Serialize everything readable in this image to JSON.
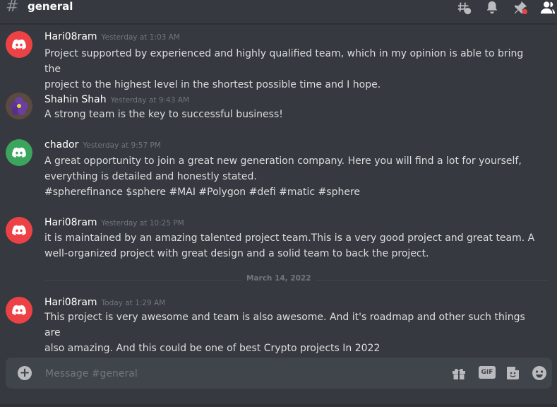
{
  "channel": {
    "hash_symbol": "#",
    "name": "general"
  },
  "header_icons": [
    "threads-icon",
    "bell-icon",
    "pin-icon",
    "members-icon"
  ],
  "colors": {
    "background": "#36393f",
    "avatar_red": "#ed4245",
    "avatar_green": "#3ba55d",
    "timestamp": "#72767d",
    "username": "#ffffff",
    "text": "#dcddde"
  },
  "messages": [
    {
      "username": "Hari08ram",
      "timestamp": "Yesterday at 1:03 AM",
      "avatar": "discord-logo-red",
      "text": "Project supported by experienced and highly qualified team, which in my opinion is able to bring the\nproject to the highest level in the shortest possible time and I hope."
    },
    {
      "username": "Shahin Shah",
      "timestamp": "Yesterday at 9:43 AM",
      "avatar": "flower-photo",
      "text": "A strong team is the key to successful business!"
    },
    {
      "username": "chador",
      "timestamp": "Yesterday at 9:57 PM",
      "avatar": "discord-logo-green",
      "text": "A great opportunity to join a great new generation company. Here you will find a lot for yourself,\neverything is detailed and honestly stated.\n#spherefinance $sphere #MAI #Polygon #defi #matic #sphere"
    },
    {
      "username": "Hari08ram",
      "timestamp": "Yesterday at 10:25 PM",
      "avatar": "discord-logo-red",
      "text": "it is maintained by an amazing talented project team.This is a very good project and great team. A\nwell-organized project with great design and a solid team to back the project."
    },
    {
      "username": "Hari08ram",
      "timestamp": "Today at 1:29 AM",
      "avatar": "discord-logo-red",
      "text": "This project is very awesome and team is also awesome. And it's roadmap and other such things are\nalso amazing. And this could be one of best Crypto projects In 2022"
    }
  ],
  "date_divider": "March 14, 2022",
  "composer": {
    "add_symbol": "+",
    "placeholder": "Message #general",
    "gif_label": "GIF",
    "icons": [
      "gift-icon",
      "gif-icon",
      "sticker-icon",
      "emoji-icon"
    ]
  }
}
